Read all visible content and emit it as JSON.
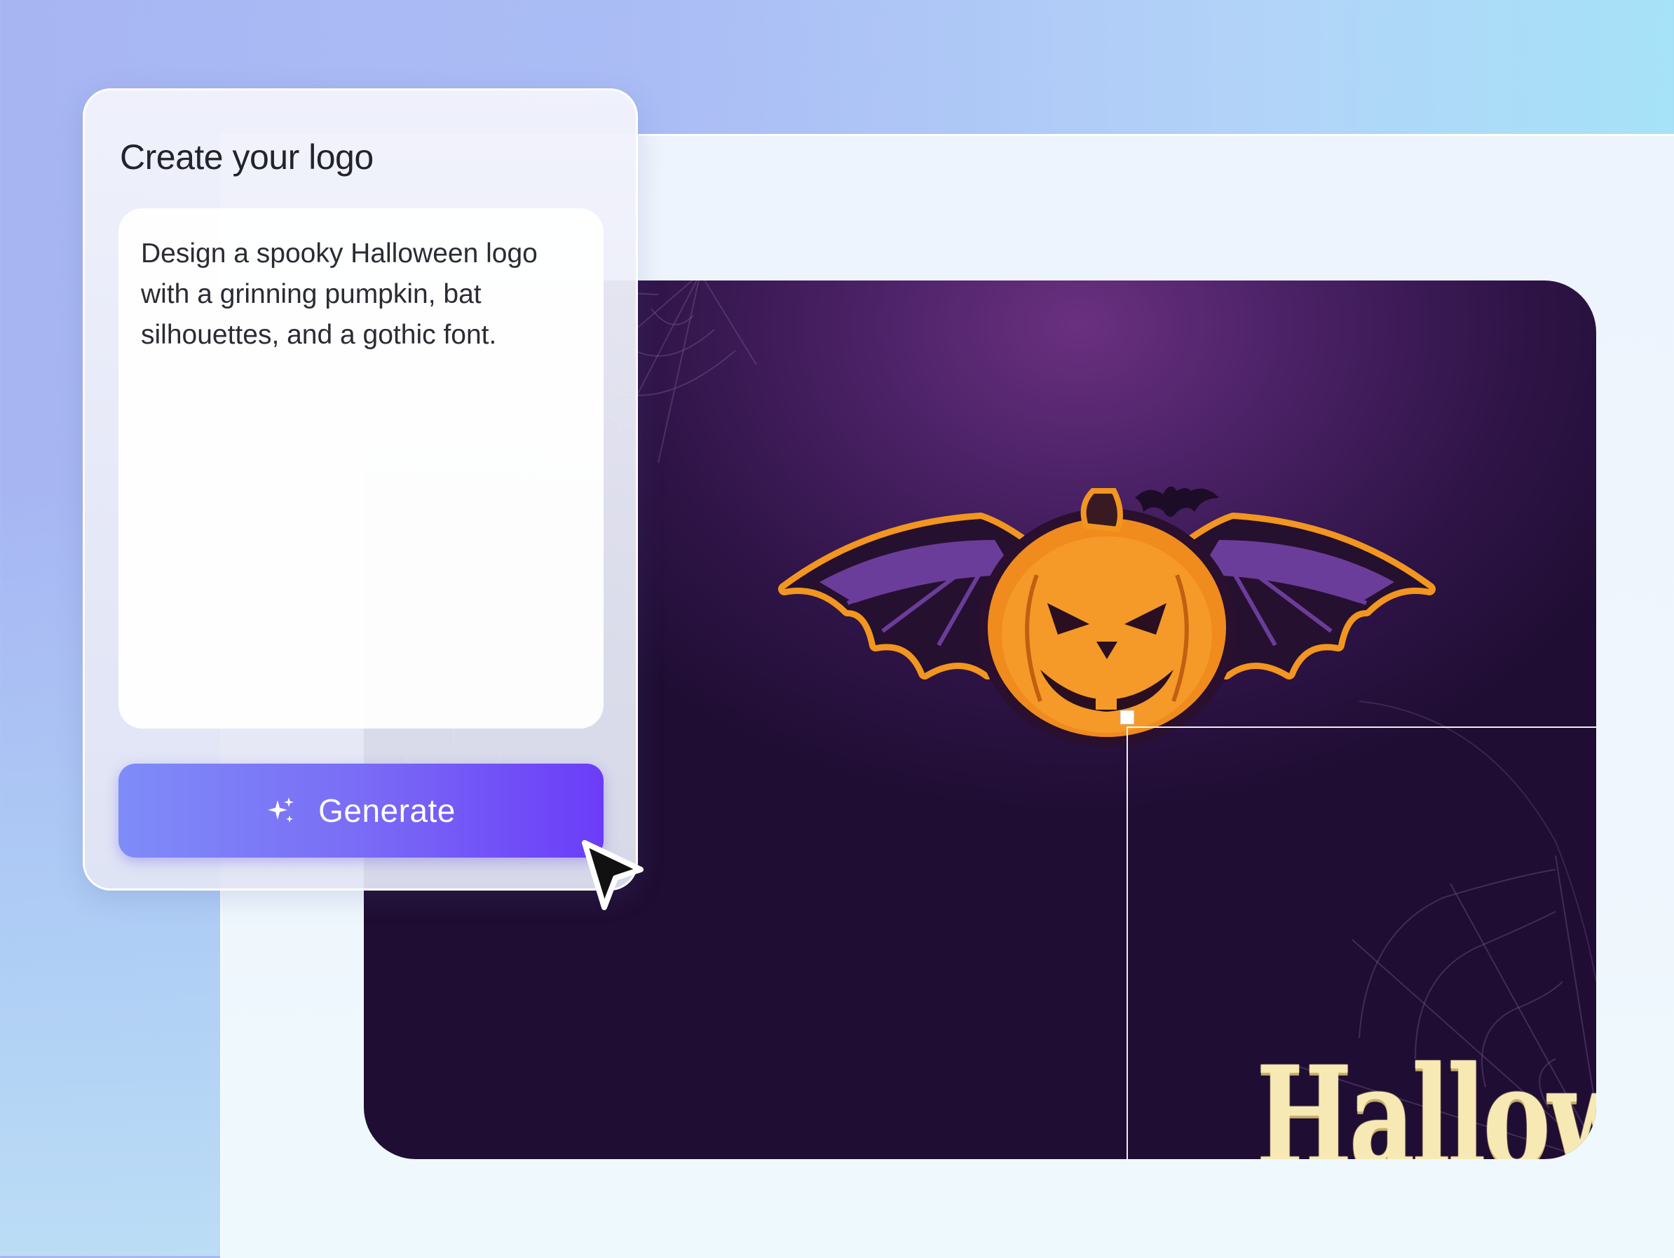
{
  "panel": {
    "title": "Create your logo",
    "prompt": "Design a spooky Halloween logo with a grinning pumpkin, bat silhouettes, and a gothic font.",
    "generate_label": "Generate"
  },
  "artwork": {
    "logo_text": "HallowGlow"
  },
  "icons": {
    "generate": "sparkle-icon",
    "cursor": "pointer-cursor-icon"
  },
  "colors": {
    "button_start": "#7f8cf8",
    "button_end": "#6b3cf8",
    "artboard_bg": "#3a1a55",
    "logo_text": "#f6e9b4",
    "pumpkin": "#f28a1d"
  }
}
